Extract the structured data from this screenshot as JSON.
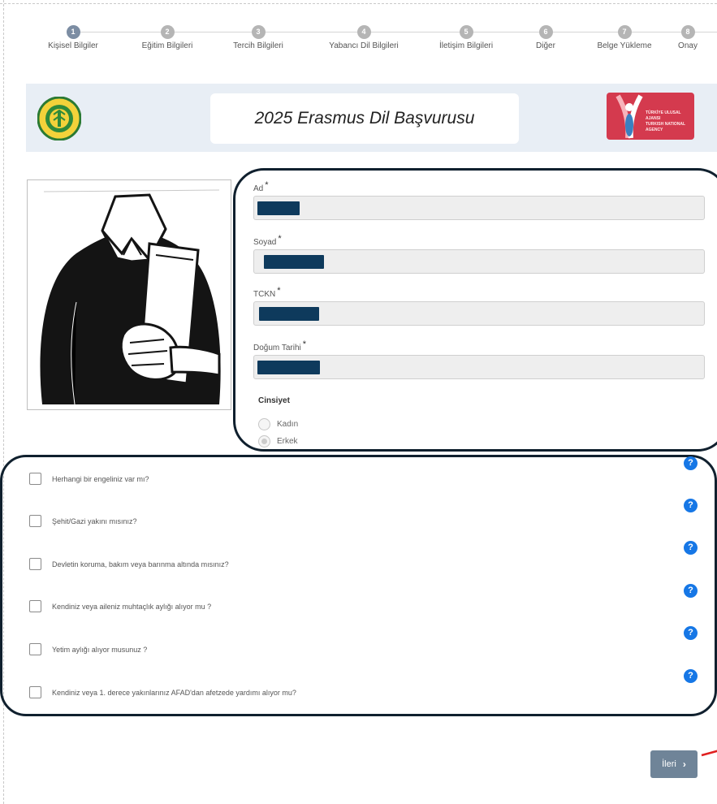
{
  "stepper": {
    "steps": [
      {
        "number": "1",
        "label": "Kişisel Bilgiler"
      },
      {
        "number": "2",
        "label": "Eğitim Bilgileri"
      },
      {
        "number": "3",
        "label": "Tercih Bilgileri"
      },
      {
        "number": "4",
        "label": "Yabancı Dil Bilgileri"
      },
      {
        "number": "5",
        "label": "İletişim Bilgileri"
      },
      {
        "number": "6",
        "label": "Diğer"
      },
      {
        "number": "7",
        "label": "Belge Yükleme"
      },
      {
        "number": "8",
        "label": "Onay"
      }
    ],
    "active_step": 1
  },
  "banner": {
    "title": "2025 Erasmus Dil Başvurusu",
    "partner_logo_text": "TÜRKİYE ULUSAL AJANSI",
    "partner_logo_subtext": "TURKISH NATIONAL AGENCY"
  },
  "form": {
    "fields": [
      {
        "label": "Ad",
        "required_mark": "*"
      },
      {
        "label": "Soyad",
        "required_mark": "*"
      },
      {
        "label": "TCKN",
        "required_mark": "*"
      },
      {
        "label": "Doğum Tarihi",
        "required_mark": "*"
      }
    ],
    "gender": {
      "title": "Cinsiyet",
      "options": [
        "Kadın",
        "Erkek"
      ],
      "selected": "Erkek"
    }
  },
  "questions": [
    "Herhangi bir engeliniz var mı?",
    "Şehit/Gazi yakını mısınız?",
    "Devletin koruma, bakım veya barınma altında mısınız?",
    "Kendiniz veya aileniz muhtaçlık aylığı alıyor mu ?",
    "Yetim aylığı alıyor musunuz ?",
    "Kendiniz veya 1. derece yakınlarınız AFAD'dan afetzede yardımı alıyor mu?"
  ],
  "help_icon_glyph": "?",
  "next_button": {
    "label": "İleri",
    "icon": "chevron-right-icon",
    "glyph": "›"
  },
  "colors": {
    "primary_button": "#6f8498",
    "help_icon": "#1677e6",
    "annotation_outline": "#10202e",
    "redaction": "#0e3a5c",
    "banner_bg": "#e8eef5",
    "partner_logo_bg": "#d43a4e"
  }
}
